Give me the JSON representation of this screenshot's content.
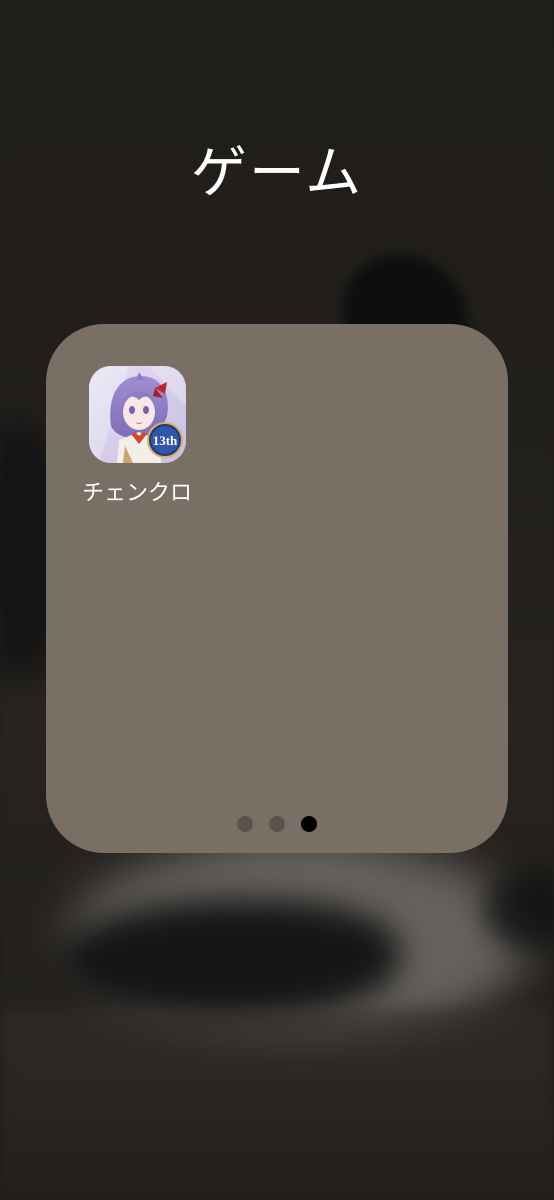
{
  "folder": {
    "title": "ゲーム",
    "apps": [
      {
        "label": "チェンクロ",
        "icon": "chain-chronicle-app-icon",
        "badge_text": "13th"
      }
    ],
    "pagination": {
      "page_count": 3,
      "current_page": 3
    }
  },
  "colors": {
    "folder_background": "#796f64",
    "dot_inactive": "#5a524b",
    "dot_active": "#000000",
    "title_text": "#ffffff"
  }
}
